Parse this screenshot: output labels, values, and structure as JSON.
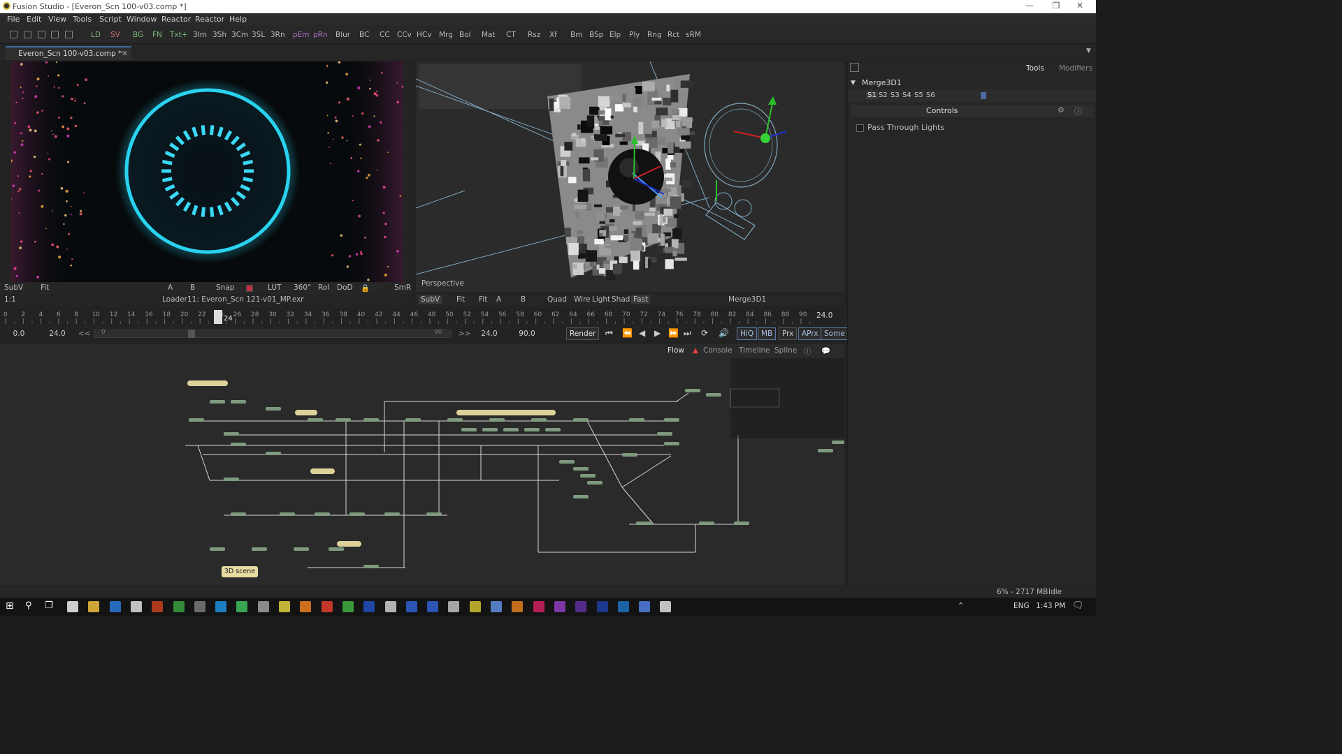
{
  "window": {
    "title": "Fusion Studio - [Everon_Scn 100-v03.comp *]",
    "minimize": "—",
    "maximize": "❐",
    "close": "✕"
  },
  "menu": [
    "File",
    "Edit",
    "View",
    "Tools",
    "Script",
    "Window",
    "Reactor",
    "Reactor",
    "Help"
  ],
  "toolbar": {
    "items": [
      "LD",
      "SV",
      "BG",
      "FN",
      "Txt+",
      "3Im",
      "3Sh",
      "3Cm",
      "3SL",
      "3Rn",
      "pEm",
      "pRn",
      "Blur",
      "BC",
      "CC",
      "CCv",
      "HCv",
      "Mrg",
      "Bol",
      "Mat",
      "CT",
      "Rsz",
      "Xf",
      "Bm",
      "BSp",
      "Elp",
      "Ply",
      "Rng",
      "Rct",
      "sRM"
    ],
    "colors": {
      "green": "#7ab87a",
      "red": "#c87070",
      "purple": "#b070c8"
    }
  },
  "tab": {
    "label": "Everon_Scn 100-v03.comp *",
    "close": "✕"
  },
  "viewerLeft": {
    "controls": [
      "SubV",
      "Fit",
      "Snap",
      "LUT",
      "360°",
      "RoI",
      "DoD",
      "SmR"
    ],
    "abc": [
      "A",
      "B"
    ],
    "scale": "1:1",
    "source": "Loader11: Everon_Scn 121-v01_MP.exr",
    "colors": {
      "ring": "#29d3f0"
    }
  },
  "viewerRight": {
    "overlay_label": "Perspective",
    "controls": [
      "SubV",
      "Fit",
      "Fit",
      "Quad",
      "Wire",
      "Light",
      "Shad",
      "Fast"
    ],
    "abc": [
      "A",
      "B"
    ],
    "node_name": "Merge3D1"
  },
  "timeline": {
    "ticks": [
      "0",
      "2",
      "4",
      "6",
      "8",
      "10",
      "12",
      "14",
      "16",
      "18",
      "20",
      "22",
      "24",
      "26",
      "28",
      "30",
      "32",
      "34",
      "36",
      "38",
      "40",
      "42",
      "44",
      "46",
      "48",
      "50",
      "52",
      "54",
      "56",
      "58",
      "60",
      "62",
      "64",
      "66",
      "68",
      "70",
      "72",
      "74",
      "76",
      "78",
      "80",
      "82",
      "84",
      "86",
      "88",
      "90"
    ],
    "current_marker": "24",
    "current_time": "24.0",
    "global_start": "0.0",
    "render_start": "24.0",
    "range_start": "0",
    "range_end": "90",
    "prev": "<<",
    "next": ">>",
    "render_end_field": "24.0",
    "global_end": "90.0",
    "render_button": "Render",
    "toggles": [
      "HiQ",
      "MB",
      "Prx",
      "APrx",
      "Some"
    ]
  },
  "flow": {
    "tabs": [
      "Flow",
      "Console",
      "Timeline",
      "Spline"
    ],
    "note_label": "3D scene"
  },
  "inspector": {
    "tabs": [
      "Tools",
      "Modifiers"
    ],
    "node": "Merge3D1",
    "versions": [
      "S1",
      "S2",
      "S3",
      "S4",
      "S5",
      "S6"
    ],
    "section": "Controls",
    "checkbox_label": "Pass Through Lights",
    "checkbox_checked": false
  },
  "status": {
    "memory": "6% - 2717 MB",
    "state": "Idle"
  },
  "taskbar": {
    "lang": "ENG",
    "time": "1:43 PM"
  }
}
